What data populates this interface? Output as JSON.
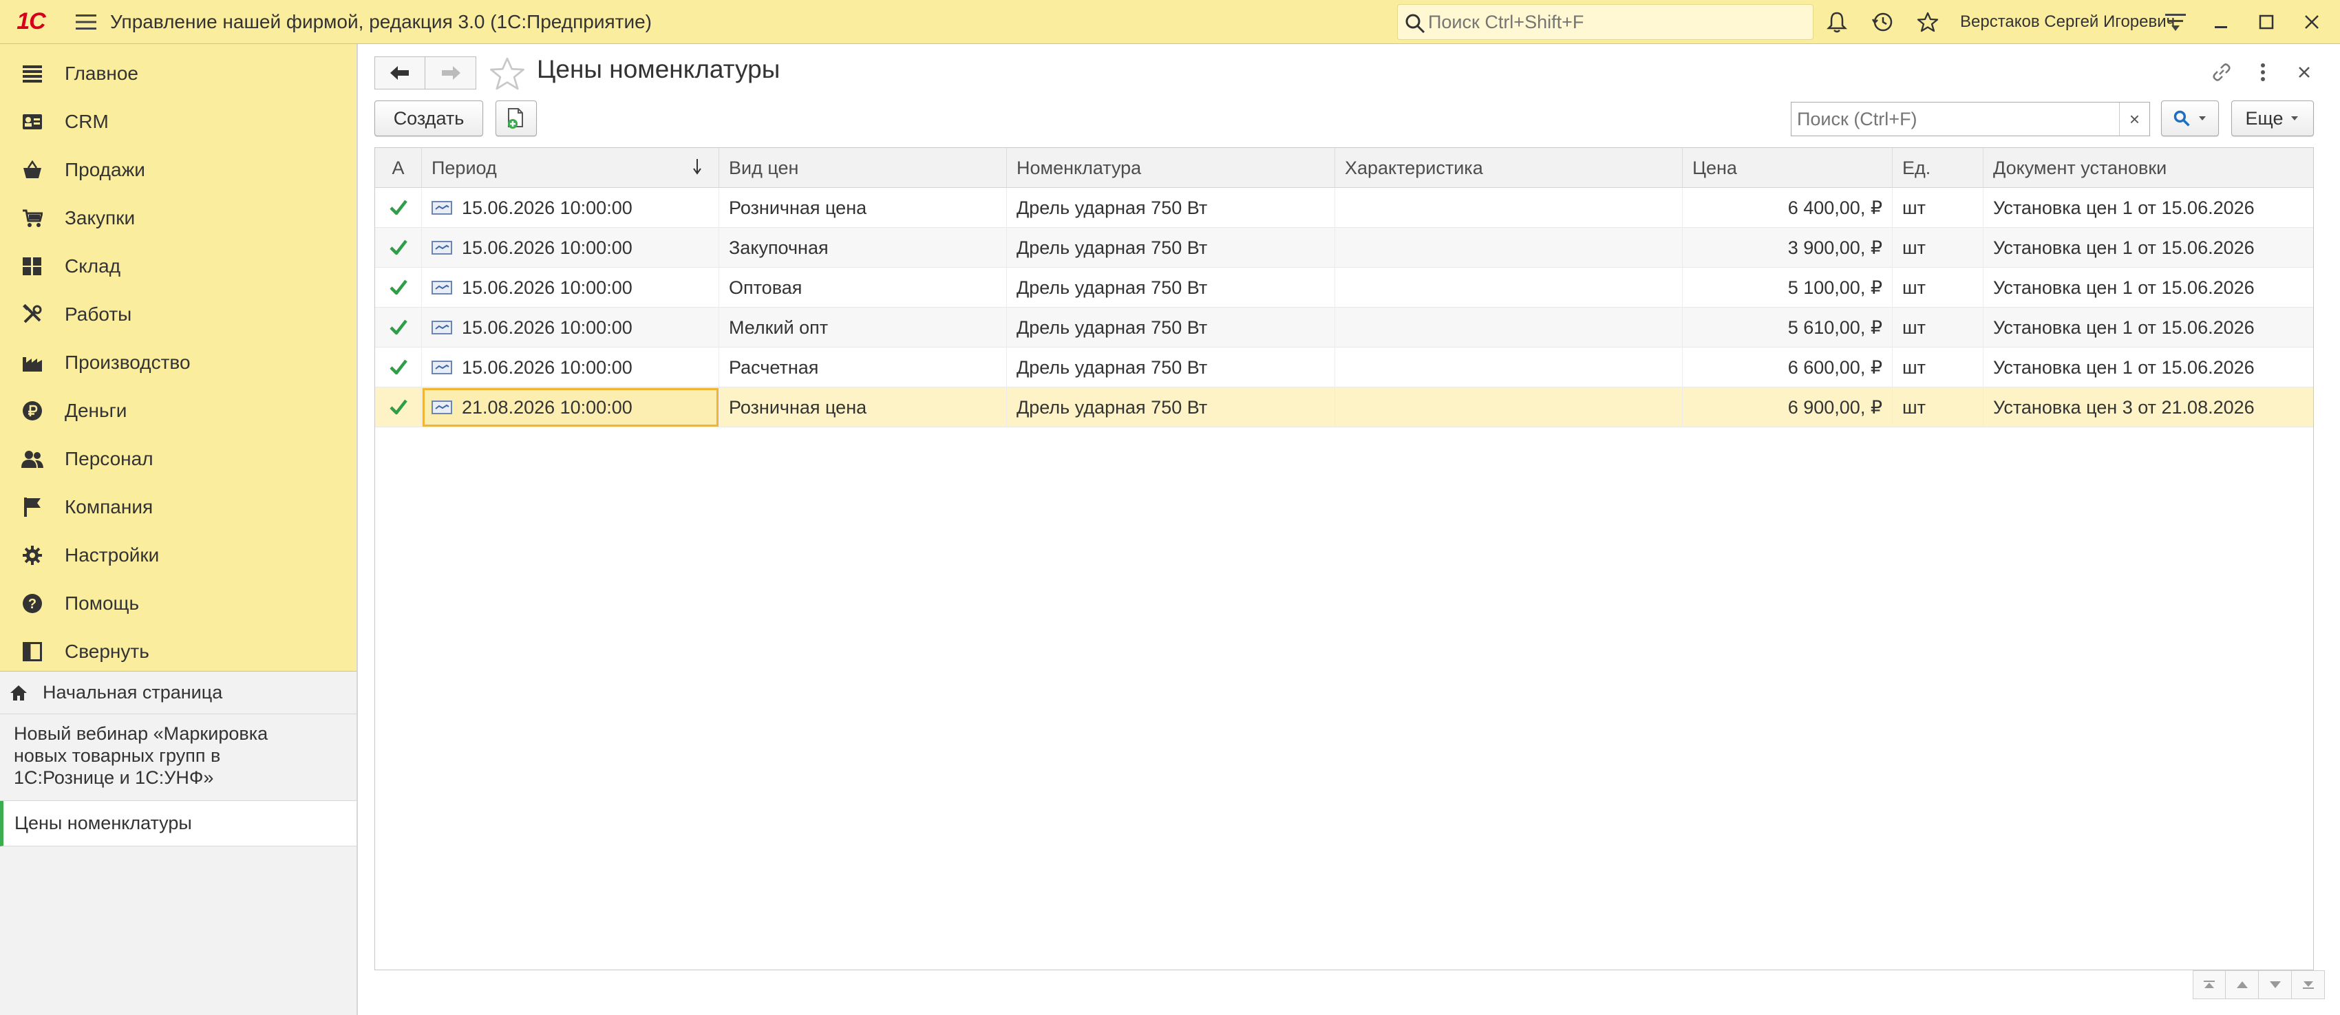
{
  "app": {
    "logo_text": "1С",
    "title": "Управление нашей фирмой, редакция 3.0  (1С:Предприятие)",
    "search_placeholder": "Поиск Ctrl+Shift+F",
    "user_name": "Верстаков Сергей Игоревич"
  },
  "sidebar": {
    "sections": [
      {
        "label": "Главное",
        "icon": "list-icon"
      },
      {
        "label": "CRM",
        "icon": "crm-icon"
      },
      {
        "label": "Продажи",
        "icon": "basket-icon"
      },
      {
        "label": "Закупки",
        "icon": "cart-icon"
      },
      {
        "label": "Склад",
        "icon": "warehouse-icon"
      },
      {
        "label": "Работы",
        "icon": "tools-icon"
      },
      {
        "label": "Производство",
        "icon": "factory-icon"
      },
      {
        "label": "Деньги",
        "icon": "ruble-icon"
      },
      {
        "label": "Персонал",
        "icon": "people-icon"
      },
      {
        "label": "Компания",
        "icon": "flag-icon"
      },
      {
        "label": "Настройки",
        "icon": "gear-icon"
      },
      {
        "label": "Помощь",
        "icon": "help-icon"
      },
      {
        "label": "Свернуть",
        "icon": "collapse-icon"
      }
    ],
    "open_windows": {
      "home": "Начальная страница",
      "webinar": "Новый вебинар «Маркировка\nновых товарных групп в\n1С:Рознице и 1С:УНФ»",
      "current": "Цены номенклатуры"
    }
  },
  "page": {
    "title": "Цены номенклатуры",
    "create_label": "Создать",
    "search_placeholder": "Поиск (Ctrl+F)",
    "clear_label": "×",
    "more_label": "Еще"
  },
  "table": {
    "columns": [
      "А",
      "Период",
      "Вид цен",
      "Номенклатура",
      "Характеристика",
      "Цена",
      "Ед.",
      "Документ установки"
    ],
    "rows": [
      {
        "active": true,
        "period": "15.06.2026 10:00:00",
        "price_type": "Розничная цена",
        "item": "Дрель ударная 750 Вт",
        "characteristic": "",
        "price": "6 400,00, ₽",
        "unit": "шт",
        "document": "Установка цен 1 от 15.06.2026"
      },
      {
        "active": true,
        "period": "15.06.2026 10:00:00",
        "price_type": "Закупочная",
        "item": "Дрель ударная 750 Вт",
        "characteristic": "",
        "price": "3 900,00, ₽",
        "unit": "шт",
        "document": "Установка цен 1 от 15.06.2026"
      },
      {
        "active": true,
        "period": "15.06.2026 10:00:00",
        "price_type": "Оптовая",
        "item": "Дрель ударная 750 Вт",
        "characteristic": "",
        "price": "5 100,00, ₽",
        "unit": "шт",
        "document": "Установка цен 1 от 15.06.2026"
      },
      {
        "active": true,
        "period": "15.06.2026 10:00:00",
        "price_type": "Мелкий опт",
        "item": "Дрель ударная 750 Вт",
        "characteristic": "",
        "price": "5 610,00, ₽",
        "unit": "шт",
        "document": "Установка цен 1 от 15.06.2026"
      },
      {
        "active": true,
        "period": "15.06.2026 10:00:00",
        "price_type": "Расчетная",
        "item": "Дрель ударная 750 Вт",
        "characteristic": "",
        "price": "6 600,00, ₽",
        "unit": "шт",
        "document": "Установка цен 1 от 15.06.2026"
      },
      {
        "active": true,
        "period": "21.08.2026 10:00:00",
        "price_type": "Розничная цена",
        "item": "Дрель ударная 750 Вт",
        "characteristic": "",
        "price": "6 900,00, ₽",
        "unit": "шт",
        "document": "Установка цен 3 от 21.08.2026"
      }
    ],
    "selected_row": 5
  },
  "colors": {
    "accent_yellow": "#fbed9e",
    "check_green": "#2e9e48",
    "logo_red": "#d6001c",
    "selection": "#fdf3c6",
    "focus_border": "#f0b533"
  }
}
